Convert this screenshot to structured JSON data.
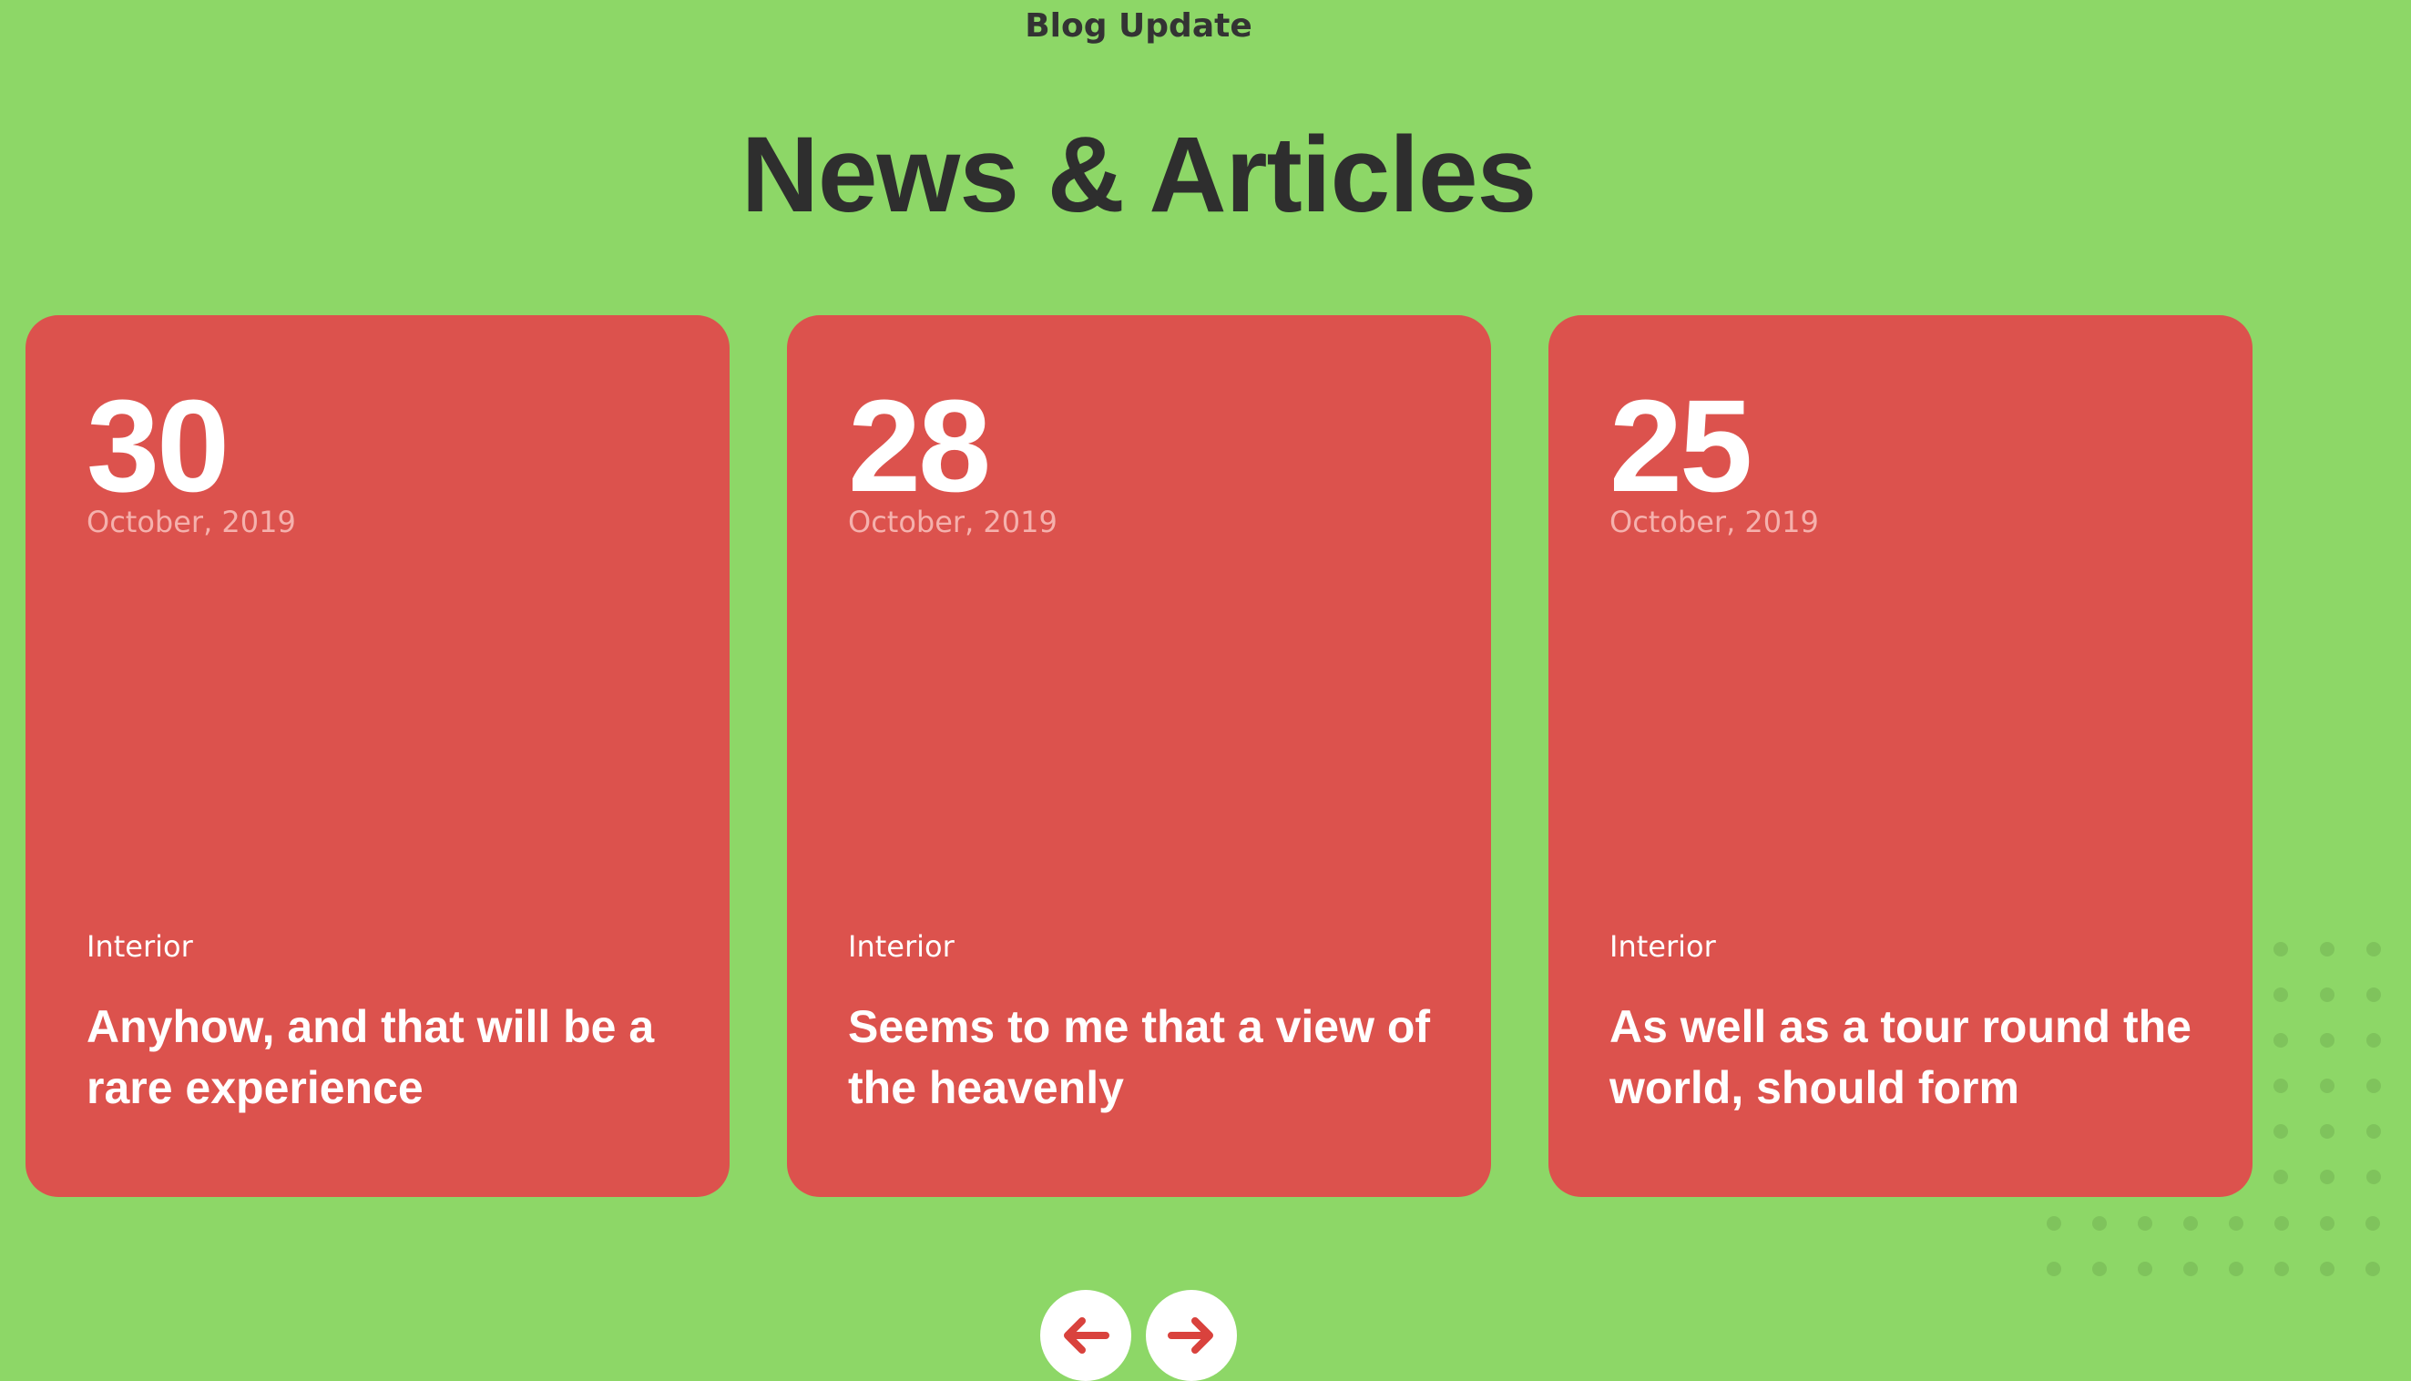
{
  "header": {
    "subtitle": "Blog Update",
    "title": "News & Articles"
  },
  "cards": [
    {
      "day": "30",
      "month": "October, 2019",
      "category": "Interior",
      "title": "Anyhow, and that will be a rare experience"
    },
    {
      "day": "28",
      "month": "October, 2019",
      "category": "Interior",
      "title": "Seems to me that a view of the heavenly"
    },
    {
      "day": "25",
      "month": "October, 2019",
      "category": "Interior",
      "title": "As well as a tour round the world, should form"
    }
  ],
  "navigation": {
    "prev_icon": "arrow-left-icon",
    "next_icon": "arrow-right-icon"
  },
  "colors": {
    "background": "#8dd767",
    "card": "#dc524d",
    "accent": "#d9423d",
    "heading": "#2e2e2e"
  }
}
